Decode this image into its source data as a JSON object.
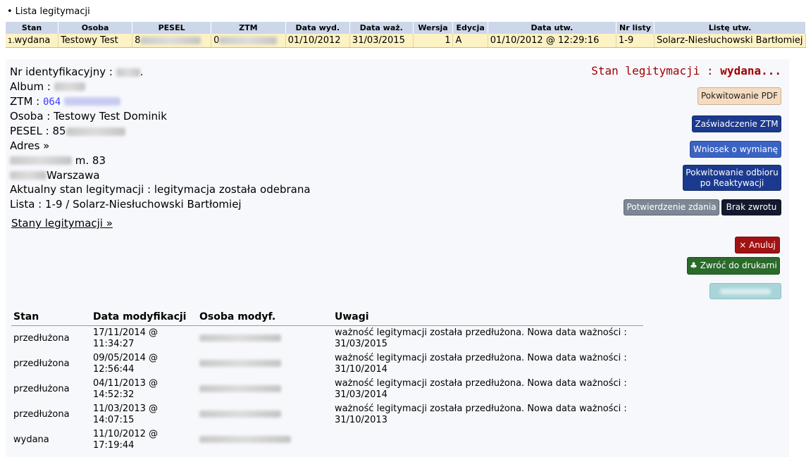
{
  "list": {
    "title": "Lista legitymacji",
    "headers": [
      "Stan",
      "Osoba",
      "PESEL",
      "ZTM",
      "Data wyd.",
      "Data waż.",
      "Wersja",
      "Edycja",
      "Data utw.",
      "Nr listy",
      "Listę utw."
    ],
    "row": {
      "lp": "1.",
      "stan": "wydana",
      "osoba": "Testowy Test",
      "pesel_prefix": "8",
      "ztm_prefix": "0",
      "data_wyd": "01/10/2012",
      "data_waz": "31/03/2015",
      "wersja": "1",
      "edycja": "A",
      "data_utw": "01/10/2012 @ 12:29:16",
      "nr_listy": "1-9",
      "liste_utw": "Solarz-Niesłuchowski Bartłomiej"
    }
  },
  "details": {
    "nr_label": "Nr identyfikacyjny :",
    "nr_suffix": ".",
    "album_label": "Album :",
    "ztm_label": "ZTM :",
    "ztm_value": "064",
    "osoba": "Osoba : Testowy Test Dominik",
    "pesel_label": "PESEL : 85",
    "adres_label": "Adres »",
    "adres_line1_suffix": "m. 83",
    "adres_line2_city": "Warszawa",
    "aktualny_stan": "Aktualny stan legitymacji : legitymacja została odebrana",
    "lista": "Lista : 1-9 / Solarz-Niesłuchowski Bartłomiej",
    "stany_link": "Stany legitymacji »"
  },
  "state_header": {
    "label": "Stan legitymacji :",
    "value": "wydana..."
  },
  "buttons": {
    "pdf": "Pokwitowanie PDF",
    "zaswiadczenie": "Zaświadczenie ZTM",
    "wniosek": "Wniosek o wymianę",
    "pokwitowanie_odbioru": "Pokwitowanie odbioru po Reaktywacji",
    "potwierdzenie": "Potwierdzenie zdania",
    "brak_zwrotu": "Brak zwrotu",
    "anuluj": "× Anuluj",
    "zwroc": "♣ Zwróć do drukarni"
  },
  "history": {
    "headers": [
      "Stan",
      "Data modyfikacji",
      "Osoba modyf.",
      "Uwagi"
    ],
    "rows": [
      {
        "stan": "przedłużona",
        "date1": "17/11/2014 @",
        "date2": "11:34:27",
        "uwagi1": "ważność legitymacji została przedłużona. Nowa data ważności :",
        "uwagi2": "31/03/2015"
      },
      {
        "stan": "przedłużona",
        "date1": "09/05/2014 @",
        "date2": "12:56:44",
        "uwagi1": "ważność legitymacji została przedłużona. Nowa data ważności :",
        "uwagi2": "31/10/2014"
      },
      {
        "stan": "przedłużona",
        "date1": "04/11/2013 @",
        "date2": "14:52:32",
        "uwagi1": "ważność legitymacji została przedłużona. Nowa data ważności :",
        "uwagi2": "31/03/2014"
      },
      {
        "stan": "przedłużona",
        "date1": "11/03/2013 @",
        "date2": "14:07:15",
        "uwagi1": "ważność legitymacji została przedłużona. Nowa data ważności :",
        "uwagi2": "31/10/2013"
      },
      {
        "stan": "wydana",
        "date1": "11/10/2012 @",
        "date2": "17:19:44",
        "uwagi1": "",
        "uwagi2": ""
      }
    ]
  }
}
